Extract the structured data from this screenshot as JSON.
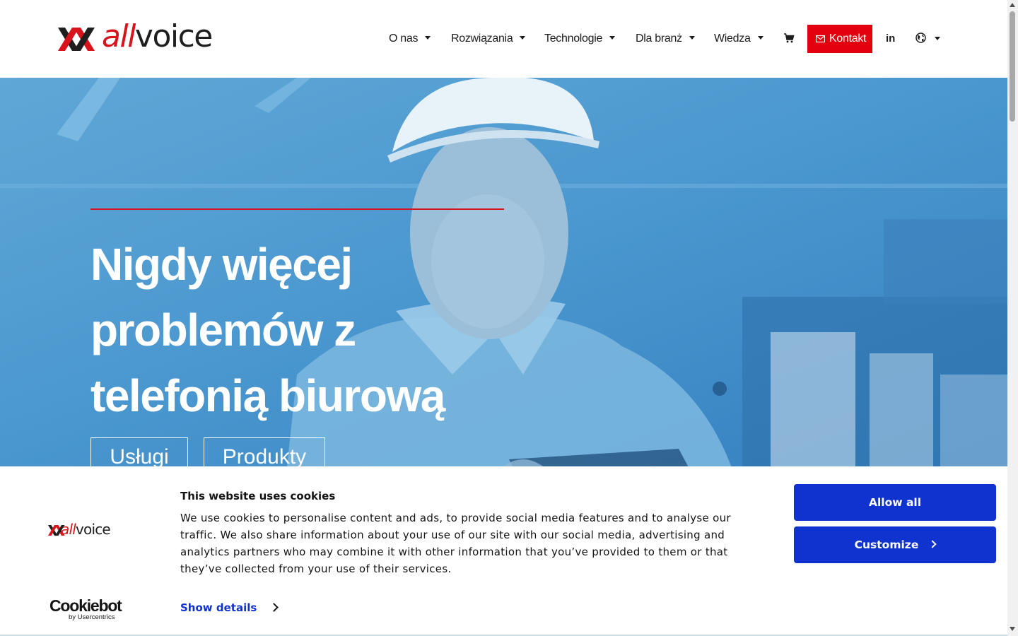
{
  "brand": {
    "name_part1": "all",
    "name_part2": "voice",
    "accent_color": "#e3000f",
    "text_color": "#1f1f1f"
  },
  "nav": {
    "items": [
      {
        "label": "O nas"
      },
      {
        "label": "Rozwiązania"
      },
      {
        "label": "Technologie"
      },
      {
        "label": "Dla branż"
      },
      {
        "label": "Wiedza"
      }
    ],
    "cart_icon": "cart-icon",
    "contact_label": "Kontakt",
    "contact_icon": "mail-icon",
    "linkedin_label": "in",
    "language_icon": "globe-icon"
  },
  "hero": {
    "title": "Nigdy więcej problemów z telefonią biurową",
    "buttons": [
      {
        "label": "Usługi"
      },
      {
        "label": "Produkty"
      }
    ],
    "overlay_color": "#3f90cc"
  },
  "cookie_banner": {
    "title": "This website uses cookies",
    "body": "We use cookies to personalise content and ads, to provide social media features and to analyse our traffic. We also share information about your use of our site with our social media, advertising and analytics partners who may combine it with other information that you’ve provided to them or that they’ve collected from your use of their services.",
    "show_details_label": "Show details",
    "allow_all_label": "Allow all",
    "customize_label": "Customize",
    "provider_name": "Cookiebot",
    "provider_by": "by Usercentrics",
    "button_color": "#1032cf"
  }
}
